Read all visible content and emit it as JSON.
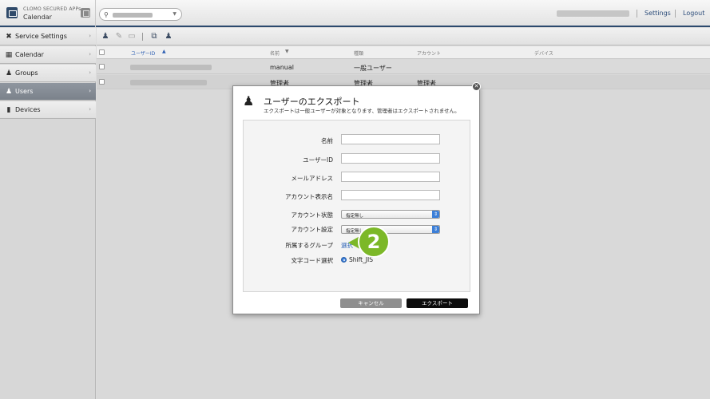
{
  "header": {
    "app_brand": "CLOMO SECURED APPs",
    "app_name": "Calendar",
    "settings_label": "Settings",
    "logout_label": "Logout"
  },
  "sidebar": {
    "items": [
      {
        "label": "Service Settings",
        "icon": "wrench-icon"
      },
      {
        "label": "Calendar",
        "icon": "calendar-icon"
      },
      {
        "label": "Groups",
        "icon": "group-icon"
      },
      {
        "label": "Users",
        "icon": "user-icon",
        "active": true
      },
      {
        "label": "Devices",
        "icon": "device-icon"
      }
    ]
  },
  "table": {
    "headers": [
      "ユーザーID",
      "名前",
      "種類",
      "アカウント",
      "デバイス"
    ],
    "rows": [
      {
        "name": "manual",
        "type": "一般ユーザー",
        "account": ""
      },
      {
        "name": "管理者",
        "type": "管理者",
        "account": "管理者"
      }
    ]
  },
  "modal": {
    "title": "ユーザーのエクスポート",
    "subtitle": "エクスポートは一般ユーザーが対象となります、管理者はエクスポートされません。",
    "fields": {
      "name_label": "名前",
      "userid_label": "ユーザーID",
      "email_label": "メールアドレス",
      "display_name_label": "アカウント表示名",
      "account_status_label": "アカウント状態",
      "account_status_value": "指定無し",
      "account_setting_label": "アカウント設定",
      "account_setting_value": "指定無し",
      "group_label": "所属するグループ",
      "group_link": "選択",
      "encoding_label": "文字コード選択",
      "encoding_value": "Shift_JIS"
    },
    "cancel_label": "キャンセル",
    "export_label": "エクスポート"
  },
  "step_marker": "2",
  "colors": {
    "header_accent": "#2c4a6e",
    "active_nav": "#868d96",
    "link": "#2c63b6",
    "step_marker": "#7cb828"
  }
}
